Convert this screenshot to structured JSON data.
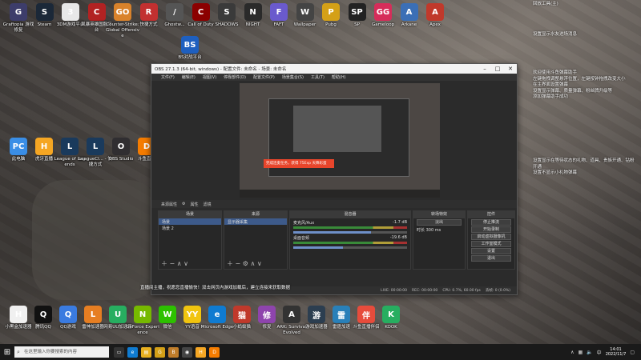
{
  "desktop_top_icons": [
    {
      "label": "Graftopia 游戏修复",
      "icon": "graftopia-icon",
      "color": "#3d3d6b",
      "glyph": "G"
    },
    {
      "label": "Steam",
      "icon": "steam-icon",
      "color": "#1b2838",
      "glyph": "S"
    },
    {
      "label": "3DM游戏平台",
      "icon": "3dm-icon",
      "color": "#e8e8e8",
      "glyph": "3"
    },
    {
      "label": "风暴英雄国服平台",
      "icon": "storm-icon",
      "color": "#b22222",
      "glyph": "C"
    },
    {
      "label": "Counter-Strike: Global Offensive",
      "icon": "csgo-icon",
      "color": "#d9822b",
      "glyph": "GO"
    },
    {
      "label": "快捷方式",
      "icon": "app-icon",
      "color": "#c23030",
      "glyph": "R"
    },
    {
      "label": "Ghostw...",
      "icon": "pen-icon",
      "color": "#555",
      "glyph": "/"
    },
    {
      "label": "Call of Duty",
      "icon": "cod-icon",
      "color": "#8b0000",
      "glyph": "C"
    },
    {
      "label": "SHADOWS",
      "icon": "game-icon",
      "color": "#3a3a3a",
      "glyph": "S"
    },
    {
      "label": "NIGHT",
      "icon": "night-icon",
      "color": "#2a2a2a",
      "glyph": "N"
    },
    {
      "label": "FAFT",
      "icon": "faft-icon",
      "color": "#6a5acd",
      "glyph": "F"
    },
    {
      "label": "Wallpaper",
      "icon": "wallpaper-icon",
      "color": "#444",
      "glyph": "W"
    },
    {
      "label": "Pubg",
      "icon": "pubg-icon",
      "color": "#d4a017",
      "glyph": "P"
    },
    {
      "label": "SP",
      "icon": "sp-icon",
      "color": "#222",
      "glyph": "SP"
    },
    {
      "label": "Gameloop",
      "icon": "gg-icon",
      "color": "#d62d5a",
      "glyph": "GG"
    },
    {
      "label": "Arkane",
      "icon": "arkane-icon",
      "color": "#3b6fb6",
      "glyph": "A"
    },
    {
      "label": "Apex",
      "icon": "apex-icon",
      "color": "#c0392b",
      "glyph": "A"
    }
  ],
  "desktop_mid_icon": {
    "label": "BS对战平台",
    "icon": "bs-icon",
    "color": "#1e5fbf",
    "glyph": "BS"
  },
  "desktop_left_icons": [
    {
      "label": "此电脑",
      "icon": "computer-icon",
      "color": "#3a8ee6",
      "glyph": "PC"
    },
    {
      "label": "虎牙直播",
      "icon": "huya-icon",
      "color": "#f5a623",
      "glyph": "H"
    },
    {
      "label": "League of Legends",
      "icon": "lol-icon",
      "color": "#1a3a5c",
      "glyph": "L"
    },
    {
      "label": "LeagueCl... - 快捷方式",
      "icon": "lol-icon",
      "color": "#1a3a5c",
      "glyph": "L"
    },
    {
      "label": "OBS Studio",
      "icon": "obs-icon",
      "color": "#302e31",
      "glyph": "O"
    },
    {
      "label": "斗鱼直播",
      "icon": "douyu-icon",
      "color": "#f57c00",
      "glyph": "D"
    }
  ],
  "desktop_bottom_icons": [
    {
      "label": "小黑盒加速器",
      "icon": "xiaoheihe-icon",
      "color": "#f0f0f0",
      "glyph": "H"
    },
    {
      "label": "腾讯QQ",
      "icon": "qq-icon",
      "color": "#111",
      "glyph": "Q"
    },
    {
      "label": "QQ游戏",
      "icon": "qqgame-icon",
      "color": "#3a7be0",
      "glyph": "Q"
    },
    {
      "label": "雷神加速器",
      "icon": "leishen-icon",
      "color": "#e67e22",
      "glyph": "L"
    },
    {
      "label": "网易UU加速器",
      "icon": "uu-icon",
      "color": "#27ae60",
      "glyph": "U"
    },
    {
      "label": "GeForce Experience",
      "icon": "nvidia-icon",
      "color": "#76b900",
      "glyph": "N"
    },
    {
      "label": "微信",
      "icon": "wechat-icon",
      "color": "#2dc100",
      "glyph": "W"
    },
    {
      "label": "YY语音",
      "icon": "yy-icon",
      "color": "#f1c40f",
      "glyph": "YY"
    },
    {
      "label": "Microsoft Edge",
      "icon": "edge-icon",
      "color": "#0f7bd1",
      "glyph": "e"
    },
    {
      "label": "小蚂蚁猫",
      "icon": "game-icon",
      "color": "#c0392b",
      "glyph": "猫"
    },
    {
      "label": "修复",
      "icon": "fix-icon",
      "color": "#8e44ad",
      "glyph": "修"
    },
    {
      "label": "ARK: Survival Evolved",
      "icon": "ark-icon",
      "color": "#333",
      "glyph": "A"
    },
    {
      "label": "游戏加速器",
      "icon": "speed-icon",
      "color": "#2c3e50",
      "glyph": "游"
    },
    {
      "label": "雷霆加速",
      "icon": "thunder-icon",
      "color": "#2980b9",
      "glyph": "雷"
    },
    {
      "label": "斗鱼直播伴侣",
      "icon": "douyu-icon",
      "color": "#e74c3c",
      "glyph": "伴"
    },
    {
      "label": "KOOK",
      "icon": "kook-icon",
      "color": "#27ae60",
      "glyph": "K"
    }
  ],
  "side_notes": {
    "top": "回放工具(主)",
    "line1": "设置显示水友进场消息",
    "block1": [
      "欢迎使用斗鱼弹幕助手",
      "左键拖拽调整悬浮位置，左键按钟拖拽改变大小",
      "在主界面设置弹幕",
      "设置显示弹幕、质量弹幕、粉丝牌升级等",
      "添加弹幕助手成功"
    ],
    "block2": [
      "设置显示在等待状态的礼物、道具、贵族开通、钻粉开通",
      "设置不显示小礼物弹幕"
    ]
  },
  "obs": {
    "title": "OBS 27.1.3 (64-bit, windows) - 配置文件: 未命名 - 场景: 未命名",
    "menu": [
      "文件(F)",
      "编辑(E)",
      "视图(V)",
      "停靠部件(D)",
      "配置文件(P)",
      "场景集合(S)",
      "工具(T)",
      "帮助(H)"
    ],
    "toast": "完成连麦任务，获得 75Exp 天降彩蛋",
    "toolbar": [
      "来源属性",
      "属性",
      "滤镜"
    ],
    "docks": {
      "scenes": {
        "header": "场景",
        "items": [
          "场景",
          "场景 2"
        ],
        "selected": 0
      },
      "sources": {
        "header": "来源",
        "items": [
          "显示器采集"
        ],
        "selected": 0
      },
      "mixer": {
        "header": "混音器",
        "channels": [
          {
            "name": "麦克风/Aux",
            "db": "-1.7 dB",
            "level": 0.68
          },
          {
            "name": "桌面音频",
            "db": "-19.6 dB",
            "level": 0.44
          }
        ]
      },
      "transitions": {
        "header": "转场特效",
        "type": "淡出",
        "duration_label": "时长",
        "duration": "300 ms"
      },
      "controls": {
        "header": "控件",
        "buttons": [
          "停止推流",
          "开始录制",
          "启动虚拟摄像机",
          "工作室模式",
          "设置",
          "退出"
        ]
      }
    },
    "status": [
      "LIVE: 00:00:00",
      "REC: 00:00:00",
      "CPU: 0.7%, 60.00 fps",
      "丢帧: 0 (0.0%)"
    ]
  },
  "below_note": "直播间主播，祝愿您直播愉快！双击网页内游戏加载后，建立连接来获取数据",
  "taskbar": {
    "search_placeholder": "在这里输入你要搜索的内容",
    "apps": [
      {
        "icon": "task-view-icon",
        "color": "#333",
        "glyph": "▭"
      },
      {
        "icon": "edge-icon",
        "color": "#0f7bd1",
        "glyph": "e"
      },
      {
        "icon": "file-explorer-icon",
        "color": "#e8b020",
        "glyph": "▤"
      },
      {
        "icon": "game-icon",
        "color": "#d4a017",
        "glyph": "G"
      },
      {
        "icon": "app-icon",
        "color": "#c07d2a",
        "glyph": "B"
      },
      {
        "icon": "obs-icon",
        "color": "#444",
        "glyph": "◉"
      },
      {
        "icon": "huya-icon",
        "color": "#f5a623",
        "glyph": "H"
      },
      {
        "icon": "douyu-icon",
        "color": "#f57c00",
        "glyph": "D"
      }
    ],
    "time": "14:01",
    "date": "2022/11/7"
  }
}
